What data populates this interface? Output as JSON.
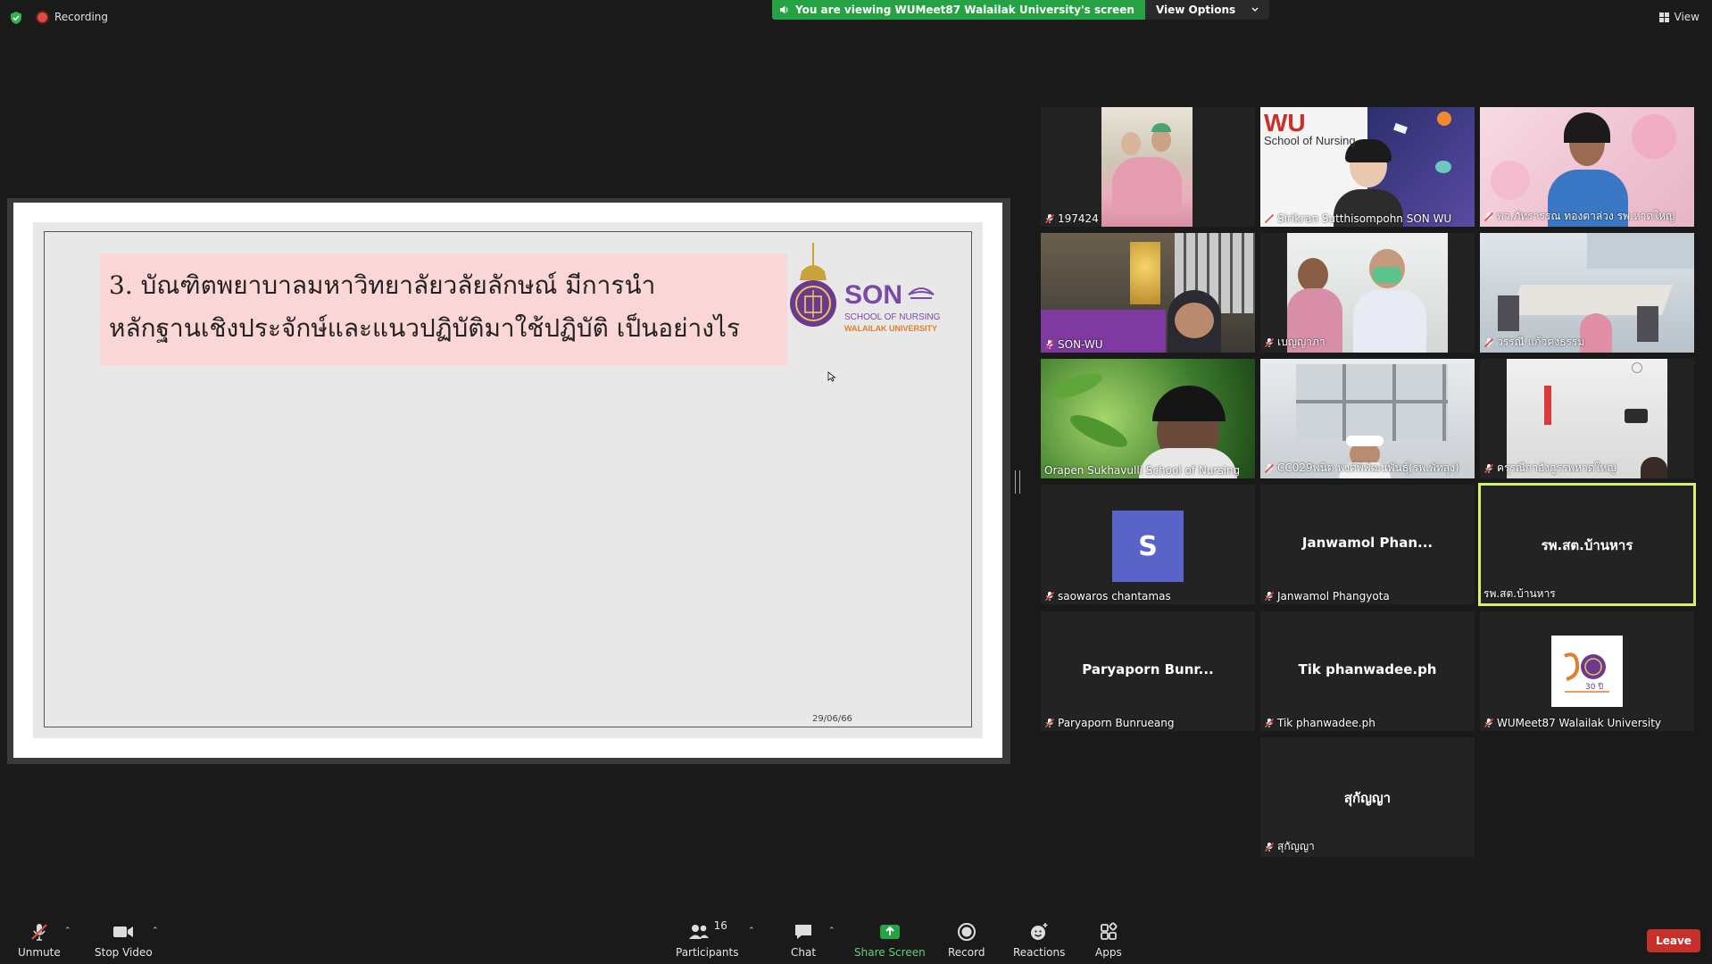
{
  "topbar": {
    "recording_label": "Recording",
    "viewing_text": "You are viewing WUMeet87 Walailak University's screen",
    "view_options_label": "View Options",
    "view_label": "View"
  },
  "slide": {
    "title_line1": "3. บัณฑิตพยาบาลมหาวิทยาลัยวลัยลักษณ์ มีการนำ",
    "title_line2": "หลักฐานเชิงประจักษ์และแนวปฏิบัติมาใช้ปฏิบัติ เป็นอย่างไร",
    "logo_main": "SON",
    "logo_sub1": "SCHOOL OF NURSING",
    "logo_sub2": "WALAILAK UNIVERSITY",
    "date": "29/06/66"
  },
  "participants": [
    {
      "name": "197424"
    },
    {
      "name": "Sirikran Sutthisompohn SON WU",
      "overlay_title": "WU",
      "overlay_sub": "School of Nursing"
    },
    {
      "name": "พว.ภัทรารรณ ทองตาล่วง รพ.หาดใหญ่"
    },
    {
      "name": "SON-WU"
    },
    {
      "name": "เบญญาภา"
    },
    {
      "name": "วรรณี แก้วคงธรรม"
    },
    {
      "name": "Orapen Sukhavulli  School of Nursing"
    },
    {
      "name": "CC029พนิต พงศ์พิพัฒนพันธุ์(รพ.พัทลุง)"
    },
    {
      "name": "ครุรณีกาอังกูรรพหาดใหญ่"
    },
    {
      "name": "saowaros chantamas",
      "avatar_letter": "S"
    },
    {
      "name": "Janwamol  Phangyota",
      "center": "Janwamol   Phan..."
    },
    {
      "name": "รพ.สต.บ้านหาร",
      "center": "รพ.สต.บ้านหาร"
    },
    {
      "name": "Paryaporn  Bunrueang",
      "center": "Paryaporn   Bunr..."
    },
    {
      "name": "Tik phanwadee.ph",
      "center": "Tik phanwadee.ph"
    },
    {
      "name": "WUMeet87 Walailak University",
      "logo_text": "30 ปี"
    },
    {
      "name": "สุกัญญา",
      "center": "สุกัญญา"
    }
  ],
  "toolbar": {
    "unmute": "Unmute",
    "stop_video": "Stop Video",
    "participants_label": "Participants",
    "participants_count": "16",
    "chat": "Chat",
    "share_screen": "Share Screen",
    "record": "Record",
    "reactions": "Reactions",
    "apps": "Apps",
    "leave": "Leave"
  },
  "colors": {
    "accent_green": "#25a244",
    "active_speaker": "#d9f06b",
    "leave_red": "#c8302a",
    "title_bg": "#fbd6d6"
  }
}
